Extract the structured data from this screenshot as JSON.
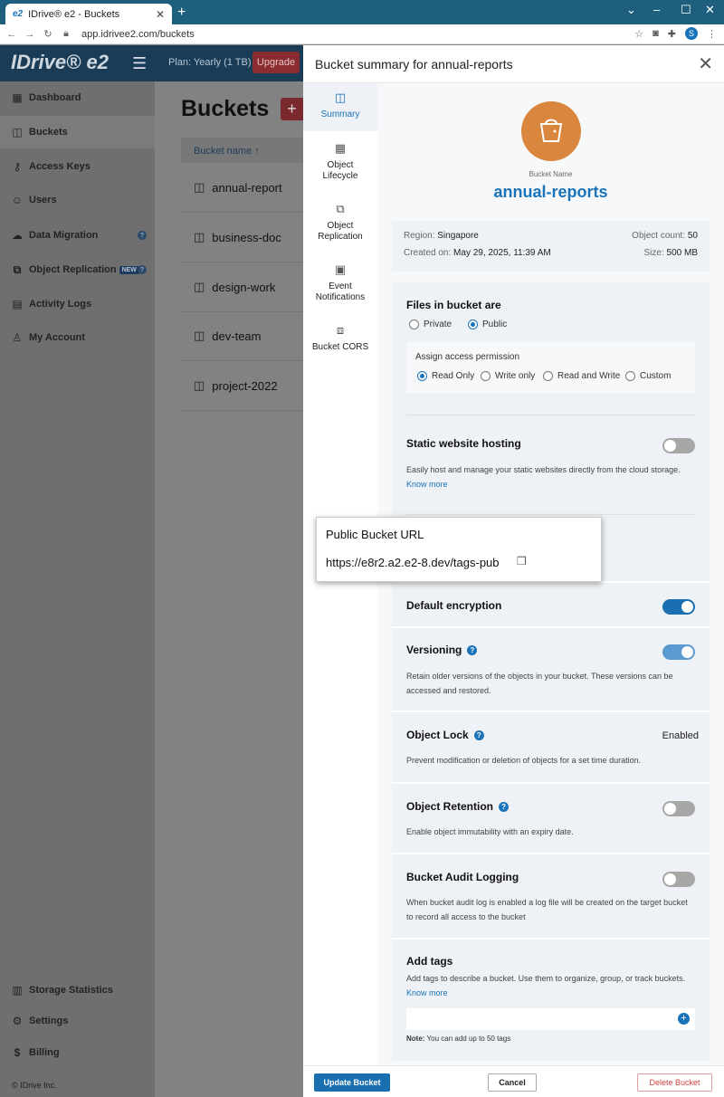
{
  "browser": {
    "tab_title": "IDrive® e2 - Buckets",
    "tab_favicon": "e2",
    "url": "app.idrivee2.com/buckets",
    "profile_initial": "S"
  },
  "app": {
    "logo": "IDrive® e2",
    "plan": "Plan: Yearly (1 TB)",
    "upgrade_label": "Upgrade",
    "sidebar": {
      "items": [
        {
          "label": "Dashboard",
          "icon": "dashboard-icon"
        },
        {
          "label": "Buckets",
          "icon": "bucket-icon"
        },
        {
          "label": "Access Keys",
          "icon": "key-icon"
        },
        {
          "label": "Users",
          "icon": "users-icon"
        },
        {
          "label": "Data Migration",
          "icon": "cloud-icon"
        },
        {
          "label": "Object Replication",
          "icon": "replication-icon",
          "badge": "NEW"
        },
        {
          "label": "Activity Logs",
          "icon": "log-icon"
        },
        {
          "label": "My Account",
          "icon": "user-icon"
        }
      ],
      "bottom_items": [
        {
          "label": "Storage Statistics",
          "icon": "stats-icon"
        },
        {
          "label": "Settings",
          "icon": "gear-icon"
        },
        {
          "label": "Billing",
          "icon": "dollar-icon"
        }
      ],
      "copyright": "© IDrive Inc."
    },
    "main": {
      "title": "Buckets",
      "add_label": "+",
      "column_header": "Bucket name",
      "sort_indicator": "↑",
      "rows": [
        "annual-report",
        "business-doc",
        "design-work",
        "dev-team",
        "project-2022"
      ]
    }
  },
  "panel": {
    "title": "Bucket summary for annual-reports",
    "tabs": [
      {
        "label": "Summary",
        "icon": "bucket-icon"
      },
      {
        "label": "Object Lifecycle",
        "icon": "calendar-icon"
      },
      {
        "label": "Object Replication",
        "icon": "replication-icon"
      },
      {
        "label": "Event Notifications",
        "icon": "notification-icon"
      },
      {
        "label": "Bucket CORS",
        "icon": "cors-icon"
      }
    ],
    "bucket_label": "Bucket Name",
    "bucket_name": "annual-reports",
    "info": {
      "region_label": "Region:",
      "region": "Singapore",
      "created_label": "Created on:",
      "created": "May 29, 2025, 11:39 AM",
      "count_label": "Object count:",
      "count": "50",
      "size_label": "Size:",
      "size": "500 MB"
    },
    "files": {
      "title": "Files in bucket are",
      "options": [
        "Private",
        "Public"
      ],
      "selected": "Public",
      "perm_title": "Assign access permission",
      "perm_options": [
        "Read Only",
        "Write only",
        "Read and Write",
        "Custom"
      ],
      "perm_selected": "Read Only"
    },
    "static": {
      "title": "Static website hosting",
      "desc": "Easily host and manage your static websites directly from the cloud storage.",
      "link": "Know more",
      "enabled": false
    },
    "tooltip": {
      "title": "Public Bucket URL",
      "url": "https://e8r2.a2.e2-8.dev/tags-pub"
    },
    "encryption": {
      "title": "Default encryption",
      "enabled": true
    },
    "versioning": {
      "title": "Versioning",
      "desc": "Retain older versions of the objects in your bucket. These versions can be accessed and restored.",
      "enabled": true
    },
    "object_lock": {
      "title": "Object Lock",
      "status": "Enabled",
      "desc": "Prevent modification or deletion of objects for a set time duration."
    },
    "retention": {
      "title": "Object Retention",
      "desc": "Enable object immutability with an expiry date.",
      "enabled": false
    },
    "audit": {
      "title": "Bucket Audit Logging",
      "desc": "When bucket audit log is enabled a log file will be created on the target bucket to record all access to the bucket",
      "enabled": false
    },
    "tags": {
      "title": "Add tags",
      "desc": "Add tags to describe a bucket. Use them to organize, group, or track buckets.",
      "link": "Know more",
      "note_label": "Note:",
      "note": "You can add up to 50 tags"
    },
    "footer": {
      "update": "Update Bucket",
      "cancel": "Cancel",
      "delete": "Delete Bucket"
    },
    "colors": {
      "accent": "#1a73b8",
      "bucket_icon_bg": "#d9873f",
      "danger": "#d04444"
    }
  }
}
